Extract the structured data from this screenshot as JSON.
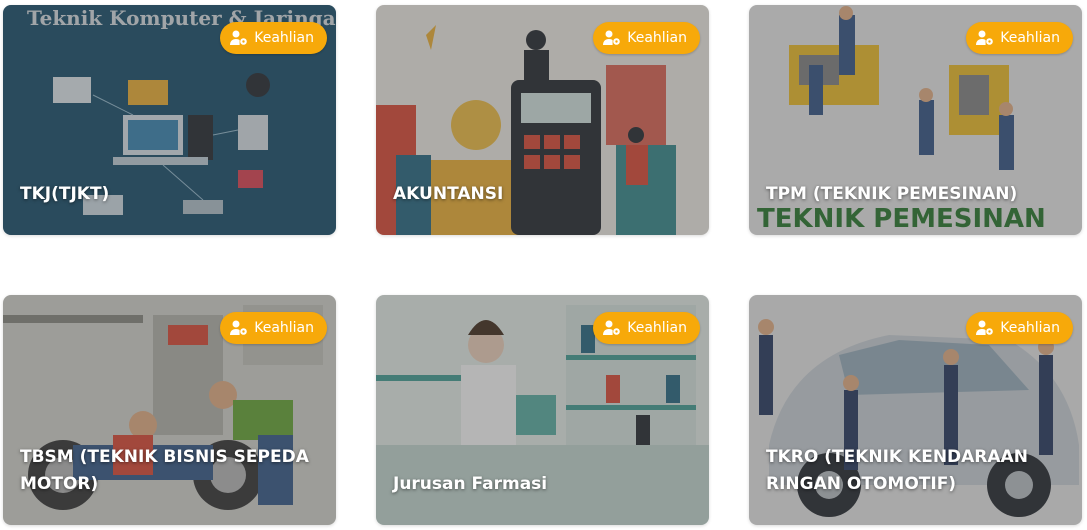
{
  "cards": [
    {
      "title": "TKJ(TJKT)",
      "badge": "Keahlian",
      "art_text": "Teknik Komputer & Jaringan",
      "bg": "#1d4f69"
    },
    {
      "title": "AKUNTANSI",
      "badge": "Keahlian",
      "bg": "#c9a45c"
    },
    {
      "title": "TPM (TEKNIK PEMESINAN)",
      "badge": "Keahlian",
      "art_text": "TEKNIK PEMESINAN",
      "bg": "#8a8a8a"
    },
    {
      "title": "TBSM (TEKNIK BISNIS SEPEDA MOTOR)",
      "badge": "Keahlian",
      "bg": "#a9a9a2"
    },
    {
      "title": "Jurusan Farmasi",
      "badge": "Keahlian",
      "bg": "#8aa8a2"
    },
    {
      "title": "TKRO (TEKNIK KENDARAAN RINGAN OTOMOTIF)",
      "badge": "Keahlian",
      "bg": "#9a9a9a"
    }
  ],
  "colors": {
    "badge": "#f7a90a",
    "title": "#ffffff"
  },
  "icons": {
    "badge": "user-gear-icon"
  }
}
